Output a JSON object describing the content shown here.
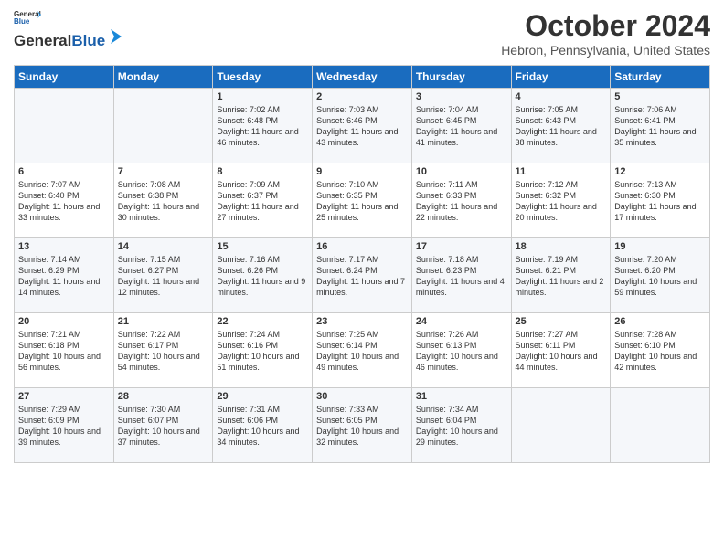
{
  "header": {
    "logo_line1": "General",
    "logo_line2": "Blue",
    "month_title": "October 2024",
    "location": "Hebron, Pennsylvania, United States"
  },
  "days_of_week": [
    "Sunday",
    "Monday",
    "Tuesday",
    "Wednesday",
    "Thursday",
    "Friday",
    "Saturday"
  ],
  "weeks": [
    [
      {
        "day": "",
        "content": ""
      },
      {
        "day": "",
        "content": ""
      },
      {
        "day": "1",
        "content": "Sunrise: 7:02 AM\nSunset: 6:48 PM\nDaylight: 11 hours and 46 minutes."
      },
      {
        "day": "2",
        "content": "Sunrise: 7:03 AM\nSunset: 6:46 PM\nDaylight: 11 hours and 43 minutes."
      },
      {
        "day": "3",
        "content": "Sunrise: 7:04 AM\nSunset: 6:45 PM\nDaylight: 11 hours and 41 minutes."
      },
      {
        "day": "4",
        "content": "Sunrise: 7:05 AM\nSunset: 6:43 PM\nDaylight: 11 hours and 38 minutes."
      },
      {
        "day": "5",
        "content": "Sunrise: 7:06 AM\nSunset: 6:41 PM\nDaylight: 11 hours and 35 minutes."
      }
    ],
    [
      {
        "day": "6",
        "content": "Sunrise: 7:07 AM\nSunset: 6:40 PM\nDaylight: 11 hours and 33 minutes."
      },
      {
        "day": "7",
        "content": "Sunrise: 7:08 AM\nSunset: 6:38 PM\nDaylight: 11 hours and 30 minutes."
      },
      {
        "day": "8",
        "content": "Sunrise: 7:09 AM\nSunset: 6:37 PM\nDaylight: 11 hours and 27 minutes."
      },
      {
        "day": "9",
        "content": "Sunrise: 7:10 AM\nSunset: 6:35 PM\nDaylight: 11 hours and 25 minutes."
      },
      {
        "day": "10",
        "content": "Sunrise: 7:11 AM\nSunset: 6:33 PM\nDaylight: 11 hours and 22 minutes."
      },
      {
        "day": "11",
        "content": "Sunrise: 7:12 AM\nSunset: 6:32 PM\nDaylight: 11 hours and 20 minutes."
      },
      {
        "day": "12",
        "content": "Sunrise: 7:13 AM\nSunset: 6:30 PM\nDaylight: 11 hours and 17 minutes."
      }
    ],
    [
      {
        "day": "13",
        "content": "Sunrise: 7:14 AM\nSunset: 6:29 PM\nDaylight: 11 hours and 14 minutes."
      },
      {
        "day": "14",
        "content": "Sunrise: 7:15 AM\nSunset: 6:27 PM\nDaylight: 11 hours and 12 minutes."
      },
      {
        "day": "15",
        "content": "Sunrise: 7:16 AM\nSunset: 6:26 PM\nDaylight: 11 hours and 9 minutes."
      },
      {
        "day": "16",
        "content": "Sunrise: 7:17 AM\nSunset: 6:24 PM\nDaylight: 11 hours and 7 minutes."
      },
      {
        "day": "17",
        "content": "Sunrise: 7:18 AM\nSunset: 6:23 PM\nDaylight: 11 hours and 4 minutes."
      },
      {
        "day": "18",
        "content": "Sunrise: 7:19 AM\nSunset: 6:21 PM\nDaylight: 11 hours and 2 minutes."
      },
      {
        "day": "19",
        "content": "Sunrise: 7:20 AM\nSunset: 6:20 PM\nDaylight: 10 hours and 59 minutes."
      }
    ],
    [
      {
        "day": "20",
        "content": "Sunrise: 7:21 AM\nSunset: 6:18 PM\nDaylight: 10 hours and 56 minutes."
      },
      {
        "day": "21",
        "content": "Sunrise: 7:22 AM\nSunset: 6:17 PM\nDaylight: 10 hours and 54 minutes."
      },
      {
        "day": "22",
        "content": "Sunrise: 7:24 AM\nSunset: 6:16 PM\nDaylight: 10 hours and 51 minutes."
      },
      {
        "day": "23",
        "content": "Sunrise: 7:25 AM\nSunset: 6:14 PM\nDaylight: 10 hours and 49 minutes."
      },
      {
        "day": "24",
        "content": "Sunrise: 7:26 AM\nSunset: 6:13 PM\nDaylight: 10 hours and 46 minutes."
      },
      {
        "day": "25",
        "content": "Sunrise: 7:27 AM\nSunset: 6:11 PM\nDaylight: 10 hours and 44 minutes."
      },
      {
        "day": "26",
        "content": "Sunrise: 7:28 AM\nSunset: 6:10 PM\nDaylight: 10 hours and 42 minutes."
      }
    ],
    [
      {
        "day": "27",
        "content": "Sunrise: 7:29 AM\nSunset: 6:09 PM\nDaylight: 10 hours and 39 minutes."
      },
      {
        "day": "28",
        "content": "Sunrise: 7:30 AM\nSunset: 6:07 PM\nDaylight: 10 hours and 37 minutes."
      },
      {
        "day": "29",
        "content": "Sunrise: 7:31 AM\nSunset: 6:06 PM\nDaylight: 10 hours and 34 minutes."
      },
      {
        "day": "30",
        "content": "Sunrise: 7:33 AM\nSunset: 6:05 PM\nDaylight: 10 hours and 32 minutes."
      },
      {
        "day": "31",
        "content": "Sunrise: 7:34 AM\nSunset: 6:04 PM\nDaylight: 10 hours and 29 minutes."
      },
      {
        "day": "",
        "content": ""
      },
      {
        "day": "",
        "content": ""
      }
    ]
  ]
}
